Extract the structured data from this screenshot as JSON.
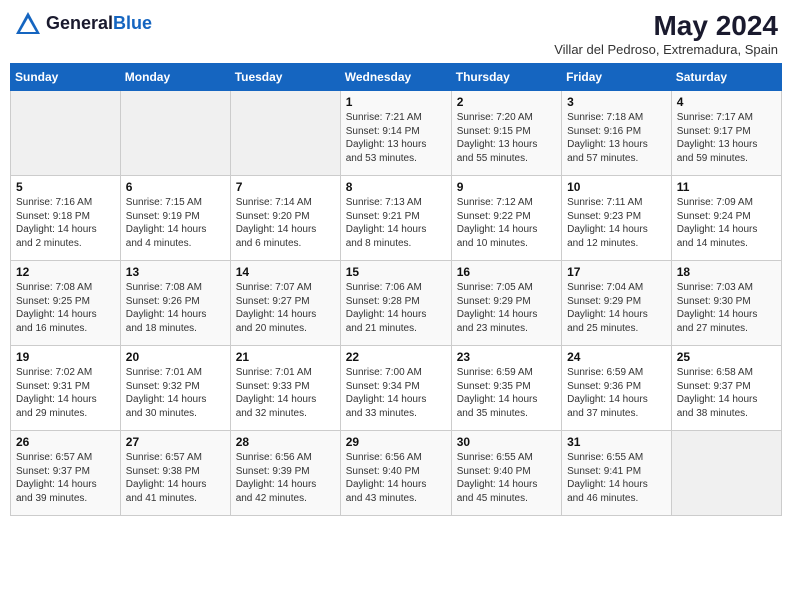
{
  "header": {
    "logo_general": "General",
    "logo_blue": "Blue",
    "month_year": "May 2024",
    "location": "Villar del Pedroso, Extremadura, Spain"
  },
  "weekdays": [
    "Sunday",
    "Monday",
    "Tuesday",
    "Wednesday",
    "Thursday",
    "Friday",
    "Saturday"
  ],
  "weeks": [
    [
      {
        "day": "",
        "info": ""
      },
      {
        "day": "",
        "info": ""
      },
      {
        "day": "",
        "info": ""
      },
      {
        "day": "1",
        "info": "Sunrise: 7:21 AM\nSunset: 9:14 PM\nDaylight: 13 hours\nand 53 minutes."
      },
      {
        "day": "2",
        "info": "Sunrise: 7:20 AM\nSunset: 9:15 PM\nDaylight: 13 hours\nand 55 minutes."
      },
      {
        "day": "3",
        "info": "Sunrise: 7:18 AM\nSunset: 9:16 PM\nDaylight: 13 hours\nand 57 minutes."
      },
      {
        "day": "4",
        "info": "Sunrise: 7:17 AM\nSunset: 9:17 PM\nDaylight: 13 hours\nand 59 minutes."
      }
    ],
    [
      {
        "day": "5",
        "info": "Sunrise: 7:16 AM\nSunset: 9:18 PM\nDaylight: 14 hours\nand 2 minutes."
      },
      {
        "day": "6",
        "info": "Sunrise: 7:15 AM\nSunset: 9:19 PM\nDaylight: 14 hours\nand 4 minutes."
      },
      {
        "day": "7",
        "info": "Sunrise: 7:14 AM\nSunset: 9:20 PM\nDaylight: 14 hours\nand 6 minutes."
      },
      {
        "day": "8",
        "info": "Sunrise: 7:13 AM\nSunset: 9:21 PM\nDaylight: 14 hours\nand 8 minutes."
      },
      {
        "day": "9",
        "info": "Sunrise: 7:12 AM\nSunset: 9:22 PM\nDaylight: 14 hours\nand 10 minutes."
      },
      {
        "day": "10",
        "info": "Sunrise: 7:11 AM\nSunset: 9:23 PM\nDaylight: 14 hours\nand 12 minutes."
      },
      {
        "day": "11",
        "info": "Sunrise: 7:09 AM\nSunset: 9:24 PM\nDaylight: 14 hours\nand 14 minutes."
      }
    ],
    [
      {
        "day": "12",
        "info": "Sunrise: 7:08 AM\nSunset: 9:25 PM\nDaylight: 14 hours\nand 16 minutes."
      },
      {
        "day": "13",
        "info": "Sunrise: 7:08 AM\nSunset: 9:26 PM\nDaylight: 14 hours\nand 18 minutes."
      },
      {
        "day": "14",
        "info": "Sunrise: 7:07 AM\nSunset: 9:27 PM\nDaylight: 14 hours\nand 20 minutes."
      },
      {
        "day": "15",
        "info": "Sunrise: 7:06 AM\nSunset: 9:28 PM\nDaylight: 14 hours\nand 21 minutes."
      },
      {
        "day": "16",
        "info": "Sunrise: 7:05 AM\nSunset: 9:29 PM\nDaylight: 14 hours\nand 23 minutes."
      },
      {
        "day": "17",
        "info": "Sunrise: 7:04 AM\nSunset: 9:29 PM\nDaylight: 14 hours\nand 25 minutes."
      },
      {
        "day": "18",
        "info": "Sunrise: 7:03 AM\nSunset: 9:30 PM\nDaylight: 14 hours\nand 27 minutes."
      }
    ],
    [
      {
        "day": "19",
        "info": "Sunrise: 7:02 AM\nSunset: 9:31 PM\nDaylight: 14 hours\nand 29 minutes."
      },
      {
        "day": "20",
        "info": "Sunrise: 7:01 AM\nSunset: 9:32 PM\nDaylight: 14 hours\nand 30 minutes."
      },
      {
        "day": "21",
        "info": "Sunrise: 7:01 AM\nSunset: 9:33 PM\nDaylight: 14 hours\nand 32 minutes."
      },
      {
        "day": "22",
        "info": "Sunrise: 7:00 AM\nSunset: 9:34 PM\nDaylight: 14 hours\nand 33 minutes."
      },
      {
        "day": "23",
        "info": "Sunrise: 6:59 AM\nSunset: 9:35 PM\nDaylight: 14 hours\nand 35 minutes."
      },
      {
        "day": "24",
        "info": "Sunrise: 6:59 AM\nSunset: 9:36 PM\nDaylight: 14 hours\nand 37 minutes."
      },
      {
        "day": "25",
        "info": "Sunrise: 6:58 AM\nSunset: 9:37 PM\nDaylight: 14 hours\nand 38 minutes."
      }
    ],
    [
      {
        "day": "26",
        "info": "Sunrise: 6:57 AM\nSunset: 9:37 PM\nDaylight: 14 hours\nand 39 minutes."
      },
      {
        "day": "27",
        "info": "Sunrise: 6:57 AM\nSunset: 9:38 PM\nDaylight: 14 hours\nand 41 minutes."
      },
      {
        "day": "28",
        "info": "Sunrise: 6:56 AM\nSunset: 9:39 PM\nDaylight: 14 hours\nand 42 minutes."
      },
      {
        "day": "29",
        "info": "Sunrise: 6:56 AM\nSunset: 9:40 PM\nDaylight: 14 hours\nand 43 minutes."
      },
      {
        "day": "30",
        "info": "Sunrise: 6:55 AM\nSunset: 9:40 PM\nDaylight: 14 hours\nand 45 minutes."
      },
      {
        "day": "31",
        "info": "Sunrise: 6:55 AM\nSunset: 9:41 PM\nDaylight: 14 hours\nand 46 minutes."
      },
      {
        "day": "",
        "info": ""
      }
    ]
  ]
}
